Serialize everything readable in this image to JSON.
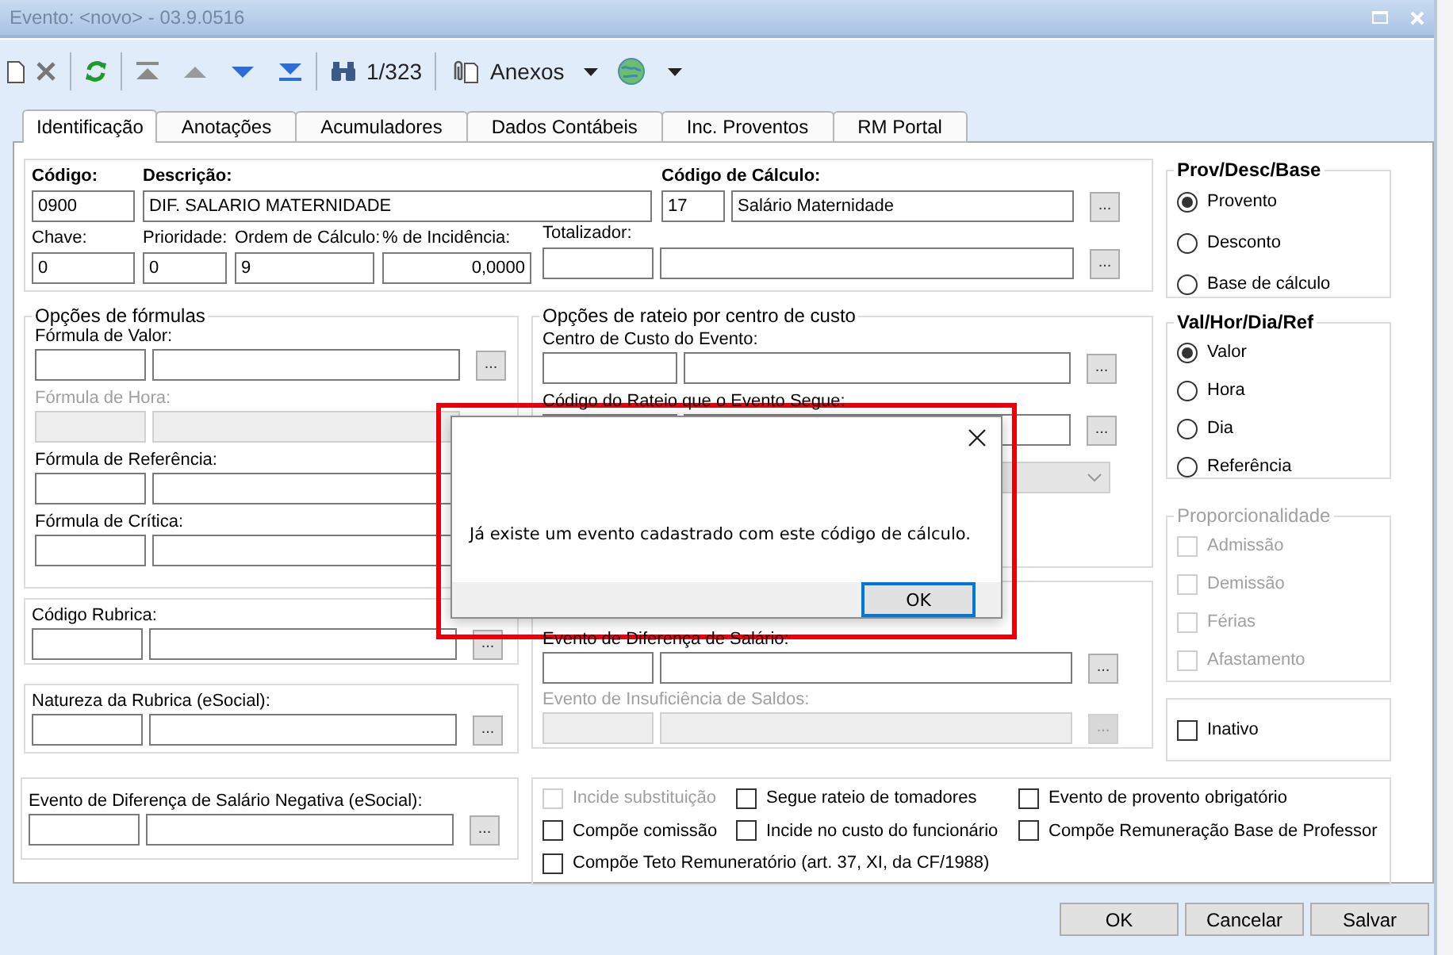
{
  "window": {
    "title": "Evento: <novo> - 03.9.0516"
  },
  "toolbar": {
    "record_counter": "1/323",
    "attachments": "Anexos"
  },
  "tabs": [
    {
      "label": "Identificação",
      "selected": true
    },
    {
      "label": "Anotações",
      "selected": false
    },
    {
      "label": "Acumuladores",
      "selected": false
    },
    {
      "label": "Dados Contábeis",
      "selected": false
    },
    {
      "label": "Inc. Proventos",
      "selected": false
    },
    {
      "label": "RM Portal",
      "selected": false
    }
  ],
  "header": {
    "codigo": {
      "label": "Código:",
      "value": "0900"
    },
    "descricao": {
      "label": "Descrição:",
      "value": "DIF. SALARIO MATERNIDADE"
    },
    "codigo_calculo": {
      "label": "Código de Cálculo:",
      "code": "17",
      "name": "Salário Maternidade",
      "button": "..."
    },
    "chave": {
      "label": "Chave:",
      "value": "0"
    },
    "prioridade": {
      "label": "Prioridade:",
      "value": "0"
    },
    "ordem_calculo": {
      "label": "Ordem de Cálculo:",
      "value": "9"
    },
    "incidencia": {
      "label": "% de Incidência:",
      "value": "0,0000"
    },
    "totalizador": {
      "label": "Totalizador:",
      "button": "..."
    }
  },
  "formulas": {
    "title": "Opções de fórmulas",
    "fields": [
      {
        "label": "Fórmula de Valor:",
        "disabled": false,
        "button": "..."
      },
      {
        "label": "Fórmula de Hora:",
        "disabled": true
      },
      {
        "label": "Fórmula de Referência:",
        "disabled": false
      },
      {
        "label": "Fórmula de Crítica:",
        "disabled": false
      }
    ]
  },
  "codigo_rubrica": {
    "label": "Código Rubrica:",
    "disabled": false,
    "button": "..."
  },
  "natureza_rubrica": {
    "label": "Natureza da Rubrica (eSocial):",
    "disabled": false,
    "button": "..."
  },
  "evento_diferenca_negativa": {
    "label": "Evento de Diferença de Salário Negativa (eSocial):",
    "disabled": false,
    "button": "..."
  },
  "rateio": {
    "title": "Opções de rateio por centro de custo",
    "fields": [
      {
        "label": "Centro de Custo do Evento:",
        "disabled": false,
        "button": "..."
      },
      {
        "label": "Código do Rateio que o Evento Segue:",
        "disabled": false,
        "button": "..."
      }
    ],
    "dropdown": {
      "disabled": true
    }
  },
  "eventos": [
    {
      "label": "Evento de Diferença de Salário:",
      "disabled": false,
      "button": "..."
    },
    {
      "label": "Evento de Insuficiência de Saldos:",
      "disabled": true,
      "button": "..."
    }
  ],
  "flags": [
    {
      "label": "Incide substituição",
      "checked": false,
      "disabled": true
    },
    {
      "label": "Segue rateio de tomadores",
      "checked": false,
      "disabled": false
    },
    {
      "label": "Evento de provento obrigatório",
      "checked": false,
      "disabled": false
    },
    {
      "label": "Compõe comissão",
      "checked": false,
      "disabled": false
    },
    {
      "label": "Incide no custo do funcionário",
      "checked": false,
      "disabled": false
    },
    {
      "label": "Compõe Remuneração Base de Professor",
      "checked": false,
      "disabled": false
    },
    {
      "label": "Compõe Teto Remuneratório (art. 37, XI, da CF/1988)",
      "checked": false,
      "disabled": false
    }
  ],
  "prov_desc_base": {
    "title": "Prov/Desc/Base",
    "options": [
      {
        "label": "Provento",
        "selected": true
      },
      {
        "label": "Desconto",
        "selected": false
      },
      {
        "label": "Base de cálculo",
        "selected": false
      }
    ]
  },
  "val_hor_dia_ref": {
    "title": "Val/Hor/Dia/Ref",
    "options": [
      {
        "label": "Valor",
        "selected": true
      },
      {
        "label": "Hora",
        "selected": false
      },
      {
        "label": "Dia",
        "selected": false
      },
      {
        "label": "Referência",
        "selected": false
      }
    ]
  },
  "proporcionalidade": {
    "title": "Proporcionalidade",
    "disabled": true,
    "items": [
      {
        "label": "Admissão",
        "checked": false
      },
      {
        "label": "Demissão",
        "checked": false
      },
      {
        "label": "Férias",
        "checked": false
      },
      {
        "label": "Afastamento",
        "checked": false
      }
    ]
  },
  "inativo": {
    "label": "Inativo",
    "checked": false
  },
  "buttons": [
    "OK",
    "Cancelar",
    "Salvar"
  ],
  "dialog": {
    "message": "Já existe um evento cadastrado com este código de cálculo.",
    "button": "OK"
  }
}
